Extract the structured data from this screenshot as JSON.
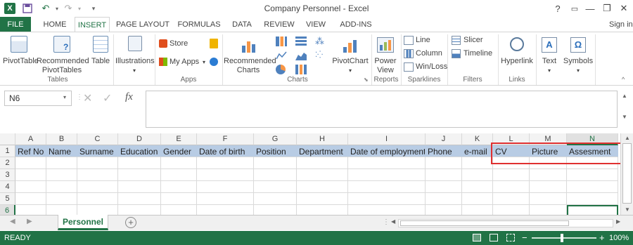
{
  "window": {
    "title": "Company Personnel - Excel",
    "signin": "Sign in",
    "min": "—",
    "restore": "❐",
    "close": "✕",
    "help": "?"
  },
  "qat": {
    "save": "💾",
    "undo": "↶",
    "redo": "↷"
  },
  "tabs": [
    "FILE",
    "HOME",
    "INSERT",
    "PAGE LAYOUT",
    "FORMULAS",
    "DATA",
    "REVIEW",
    "VIEW",
    "ADD-INS"
  ],
  "ribbon": {
    "pivottable": "PivotTable",
    "recommended_pivot": [
      "Recommended",
      "PivotTables"
    ],
    "table": "Table",
    "illustrations": "Illustrations",
    "store": "Store",
    "myapps": "My Apps",
    "recommended_charts": [
      "Recommended",
      "Charts"
    ],
    "pivotchart": "PivotChart",
    "powerview": [
      "Power",
      "View"
    ],
    "line": "Line",
    "column": "Column",
    "winloss": "Win/Loss",
    "slicer": "Slicer",
    "timeline": "Timeline",
    "hyperlink": "Hyperlink",
    "text": "Text",
    "symbols": "Symbols",
    "groups": {
      "tables": "Tables",
      "apps": "Apps",
      "charts": "Charts",
      "reports": "Reports",
      "sparklines": "Sparklines",
      "filters": "Filters",
      "links": "Links"
    }
  },
  "formula_bar": {
    "namebox": "N6",
    "fx": "fx",
    "value": ""
  },
  "columns": [
    "A",
    "B",
    "C",
    "D",
    "E",
    "F",
    "G",
    "H",
    "I",
    "J",
    "K",
    "L",
    "M",
    "N"
  ],
  "rows": [
    "1",
    "2",
    "3",
    "4",
    "5",
    "6"
  ],
  "headers": [
    "Ref No",
    "Name",
    "Surname",
    "Education",
    "Gender",
    "Date of birth",
    "Position",
    "Department",
    "Date of employment",
    "Phone",
    "e-mail",
    "CV",
    "Picture",
    "Assesment"
  ],
  "sheet": {
    "tab": "Personnel",
    "add": "+"
  },
  "status": {
    "ready": "READY",
    "zoom": "100%"
  },
  "colors": {
    "accent": "#217346",
    "header_fill": "#b8cce4",
    "highlight": "#e03030"
  }
}
